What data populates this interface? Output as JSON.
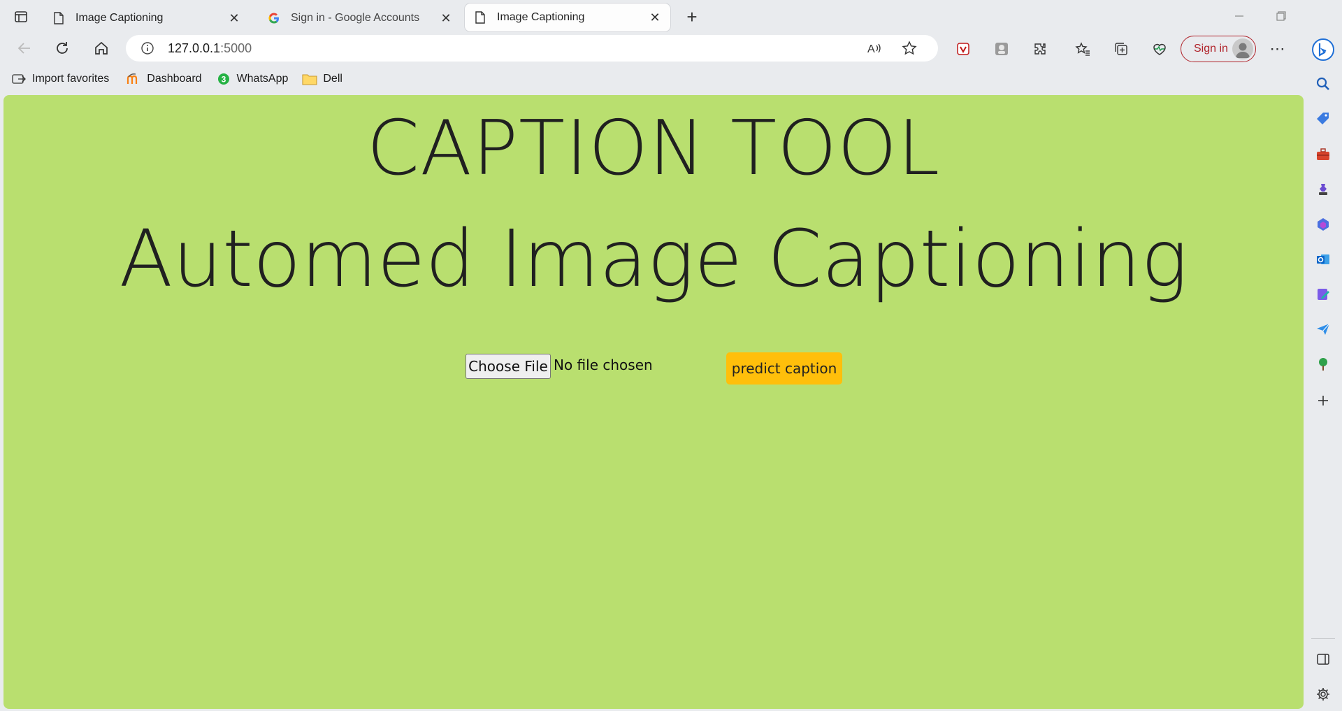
{
  "tabs": [
    {
      "title": "Image Captioning",
      "icon": "page-icon",
      "active": false
    },
    {
      "title": "Sign in - Google Accounts",
      "icon": "google-icon",
      "active": false
    },
    {
      "title": "Image Captioning",
      "icon": "page-icon",
      "active": true
    }
  ],
  "address_bar": {
    "host": "127.0.0.1",
    "port": ":5000"
  },
  "toolbar": {
    "signin_label": "Sign in"
  },
  "favorites": [
    {
      "label": "Import favorites",
      "icon": "import-icon"
    },
    {
      "label": "Dashboard",
      "icon": "moodle-icon"
    },
    {
      "label": "WhatsApp",
      "icon": "whatsapp-icon",
      "badge": "3"
    },
    {
      "label": "Dell",
      "icon": "folder-icon"
    }
  ],
  "page": {
    "title": "CAPTION TOOL",
    "subtitle": "Automed Image Captioning",
    "file_button_label": "Choose File",
    "file_status": "No file chosen",
    "predict_button_label": "predict caption"
  },
  "colors": {
    "page_background": "#b9df6f",
    "predict_button": "#ffbf0b",
    "signin_accent": "#b0232a"
  }
}
